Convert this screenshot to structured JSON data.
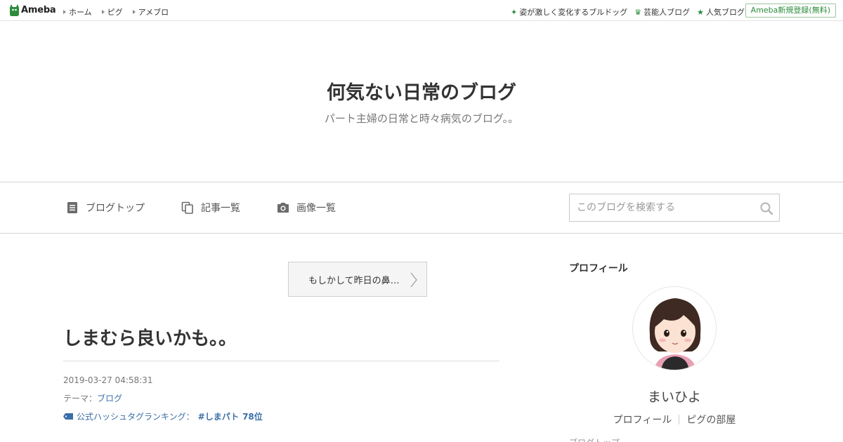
{
  "topbar": {
    "logo_text": "Ameba",
    "nav": [
      "ホーム",
      "ピグ",
      "アメブロ"
    ],
    "right_links": [
      {
        "icon": "sparkle-icon",
        "label": "姿が激しく変化するブルドッグ"
      },
      {
        "icon": "crown-icon",
        "label": "芸能人ブログ"
      },
      {
        "icon": "star-icon",
        "label": "人気ブログ"
      }
    ],
    "signup_label": "Ameba新規登録(無料)"
  },
  "header": {
    "title": "何気ない日常のブログ",
    "description": "パート主婦の日常と時々病気のブログ。。"
  },
  "navbar": {
    "items": [
      {
        "icon": "document-icon",
        "label": "ブログトップ"
      },
      {
        "icon": "copy-icon",
        "label": "記事一覧"
      },
      {
        "icon": "camera-icon",
        "label": "画像一覧"
      }
    ],
    "search_placeholder": "このブログを検索する"
  },
  "article": {
    "prev_label": "もしかして昨日の鼻…",
    "title": "しまむら良いかも。。",
    "date": "2019-03-27 04:58:31",
    "theme_prefix": "テーマ：",
    "theme": "ブログ",
    "hashtag_prefix": "公式ハッシュタグランキング：",
    "hashtag": "#しまパト",
    "rank": "78位"
  },
  "sidebar": {
    "heading": "プロフィール",
    "name": "まいひよ",
    "links": [
      "プロフィール",
      "ピグの部屋"
    ],
    "cut_text": "ブログトップ"
  },
  "colors": {
    "brand_green": "#2d8c3c",
    "link_blue": "#3b6ea8"
  }
}
